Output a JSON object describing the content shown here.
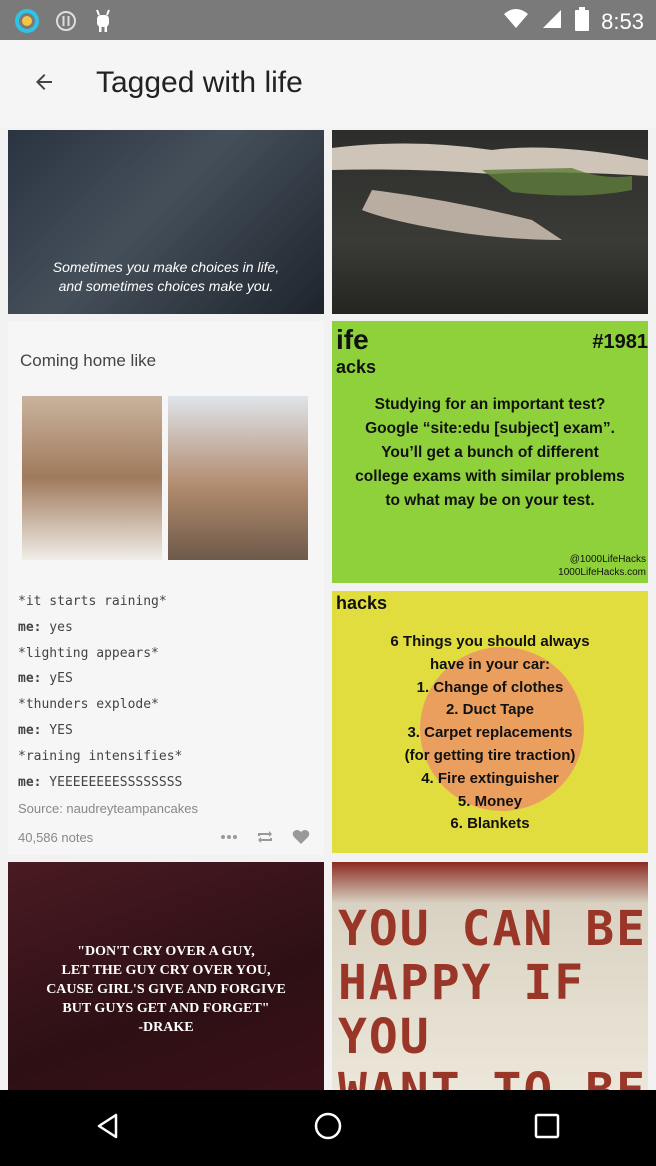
{
  "status_bar": {
    "time": "8:53",
    "icons": [
      "ring-icon",
      "alert-icon",
      "android-icon",
      "wifi-icon",
      "signal-icon",
      "battery-icon"
    ]
  },
  "appbar": {
    "title": "Tagged with life",
    "back_icon": "arrow-back-icon"
  },
  "tiles": {
    "t1": {
      "caption": "Sometimes you make choices in life,\nand sometimes choices make you."
    },
    "t3": {
      "heading": "Coming home like",
      "lines": [
        {
          "prefix": "",
          "text": "*it starts raining*"
        },
        {
          "prefix": "me:",
          "text": " yes"
        },
        {
          "prefix": "",
          "text": "*lighting appears*"
        },
        {
          "prefix": "me:",
          "text": " yES"
        },
        {
          "prefix": "",
          "text": "*thunders explode*"
        },
        {
          "prefix": "me:",
          "text": " YES"
        },
        {
          "prefix": "",
          "text": "*raining intensifies*"
        },
        {
          "prefix": "me:",
          "text": " YEEEEEEEESSSSSSSS"
        }
      ],
      "source": "Source: naudreyteampancakes",
      "notes": "40,586 notes"
    },
    "t4": {
      "title_big": "ife",
      "title_small": "acks",
      "number": "#1981",
      "text": "Studying for an important test?\nGoogle “site:edu [subject] exam”.\nYou’ll get a bunch of different\ncollege exams with similar problems\nto what may be on your test.",
      "footer": "@1000LifeHacks\n1000LifeHacks.com"
    },
    "t5": {
      "title_small": "hacks",
      "text": "6 Things you should always\nhave in your car:\n1. Change of clothes\n2. Duct Tape\n3. Carpet replacements\n(for getting tire traction)\n4. Fire extinguisher\n5. Money\n6. Blankets"
    },
    "t6": {
      "quote": "\"DON'T CRY OVER A GUY,\nLET THE GUY CRY OVER YOU,\nCAUSE GIRL'S GIVE AND FORGIVE\nBUT GUYS GET AND FORGET\"\n-DRAKE"
    },
    "t7": {
      "sign": "YOU CAN BE\nHAPPY IF YOU\nWANT TO BE"
    }
  },
  "navbar": {
    "back": "nav-back-icon",
    "home": "nav-home-icon",
    "recents": "nav-recents-icon"
  }
}
